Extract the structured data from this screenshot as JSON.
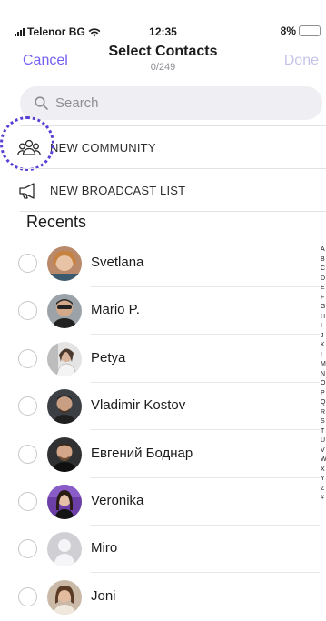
{
  "status_bar": {
    "carrier": "Telenor BG",
    "time": "12:35",
    "battery": "8%",
    "battery_level": 0.08
  },
  "nav": {
    "cancel_label": "Cancel",
    "title": "Select Contacts",
    "count": "0/249",
    "done_label": "Done"
  },
  "search": {
    "placeholder": "Search",
    "value": ""
  },
  "actions": {
    "community_label": "NEW COMMUNITY",
    "broadcast_label": "NEW BROADCAST LIST"
  },
  "recents_header": "Recents",
  "contacts": [
    {
      "name": "Svetlana"
    },
    {
      "name": "Mario P."
    },
    {
      "name": "Petya"
    },
    {
      "name": "Vladimir Kostov"
    },
    {
      "name": "Евгений Боднар"
    },
    {
      "name": "Veronika"
    },
    {
      "name": "Miro"
    },
    {
      "name": "Joni"
    }
  ],
  "alphabet_index": [
    "A",
    "B",
    "C",
    "D",
    "E",
    "F",
    "G",
    "H",
    "I",
    "J",
    "K",
    "L",
    "M",
    "N",
    "O",
    "P",
    "Q",
    "R",
    "S",
    "T",
    "U",
    "V",
    "W",
    "X",
    "Y",
    "Z",
    "#"
  ],
  "colors": {
    "accent": "#7360f2",
    "done_disabled": "#c6c3e8",
    "highlight_ring": "#5a3fd6"
  }
}
